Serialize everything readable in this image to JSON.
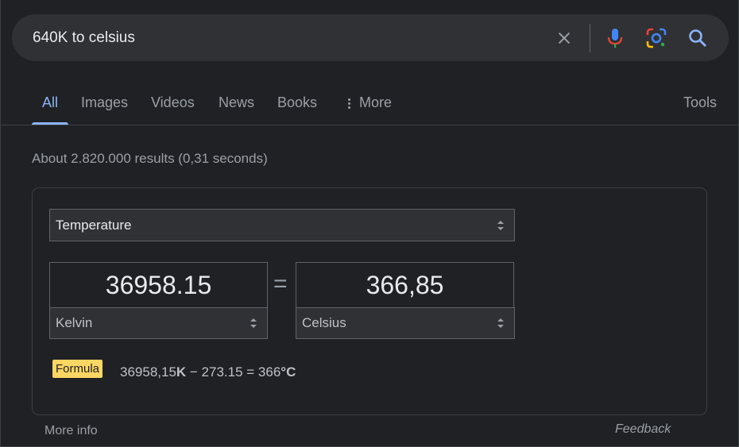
{
  "search": {
    "query": "640K to celsius"
  },
  "tabs": [
    {
      "label": "All",
      "active": true
    },
    {
      "label": "Images"
    },
    {
      "label": "Videos"
    },
    {
      "label": "News"
    },
    {
      "label": "Books"
    },
    {
      "label": "More"
    }
  ],
  "tools_label": "Tools",
  "result_stats": "About 2.820.000 results (0,31 seconds)",
  "converter": {
    "category": "Temperature",
    "from_value": "36958.15",
    "from_unit": "Kelvin",
    "equals_sign": "=",
    "to_value": "366,85",
    "to_unit": "Celsius",
    "formula_label": "Formula",
    "formula": {
      "part1": "36958,15",
      "unit1": "K",
      "part2": " − 273.15 = 366",
      "unit2": "°C"
    }
  },
  "footer": {
    "more_info": "More info",
    "feedback": "Feedback"
  },
  "colors": {
    "background": "#202124",
    "accent": "#8ab4f8",
    "formula_badge": "#fdd663"
  }
}
